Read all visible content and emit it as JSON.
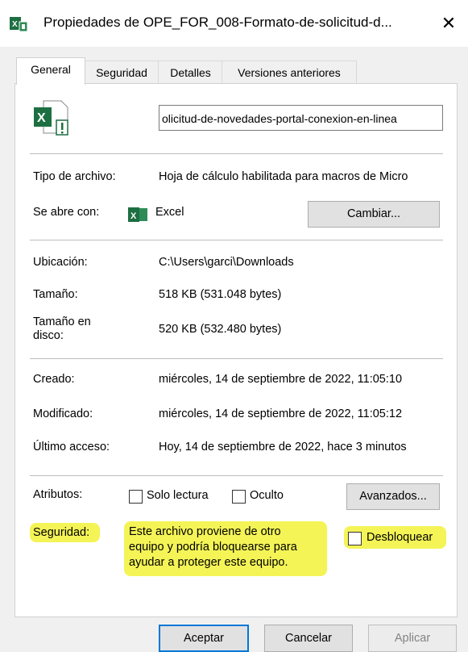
{
  "window": {
    "title": "Propiedades de OPE_FOR_008-Formato-de-solicitud-d...",
    "close_glyph": "✕"
  },
  "tabs": [
    {
      "label": "General",
      "active": true
    },
    {
      "label": "Seguridad",
      "active": false
    },
    {
      "label": "Detalles",
      "active": false
    },
    {
      "label": "Versiones anteriores",
      "active": false
    }
  ],
  "file": {
    "icon": "excel-file-icon",
    "name": "olicitud-de-novedades-portal-conexion-en-linea"
  },
  "type": {
    "label": "Tipo de archivo:",
    "value": "Hoja de cálculo habilitada para macros de Micro"
  },
  "opens_with": {
    "label": "Se abre con:",
    "app": "Excel",
    "app_icon": "excel-icon",
    "change_button": "Cambiar..."
  },
  "location": {
    "label": "Ubicación:",
    "value": "C:\\Users\\garci\\Downloads"
  },
  "size": {
    "label": "Tamaño:",
    "value": "518 KB (531.048 bytes)"
  },
  "size_on_disk": {
    "label_line1": "Tamaño en",
    "label_line2": "disco:",
    "value": "520 KB (532.480 bytes)"
  },
  "created": {
    "label": "Creado:",
    "value": "miércoles, 14 de septiembre de 2022, 11:05:10"
  },
  "modified": {
    "label": "Modificado:",
    "value": "miércoles, 14 de septiembre de 2022, 11:05:12"
  },
  "accessed": {
    "label": "Último acceso:",
    "value": "Hoy, 14 de septiembre de 2022, hace 3 minutos"
  },
  "attributes": {
    "label": "Atributos:",
    "readonly": "Solo lectura",
    "hidden": "Oculto",
    "advanced_button": "Avanzados..."
  },
  "security": {
    "label": "Seguridad:",
    "line1": "Este archivo proviene de otro",
    "line2": "equipo y podría bloquearse para",
    "line3": "ayudar a proteger este equipo.",
    "unblock": "Desbloquear",
    "highlight_color": "#f2f23a"
  },
  "footer": {
    "ok": "Aceptar",
    "cancel": "Cancelar",
    "apply": "Aplicar"
  },
  "colors": {
    "accent": "#0078d7",
    "excel_green": "#1d6f42"
  }
}
